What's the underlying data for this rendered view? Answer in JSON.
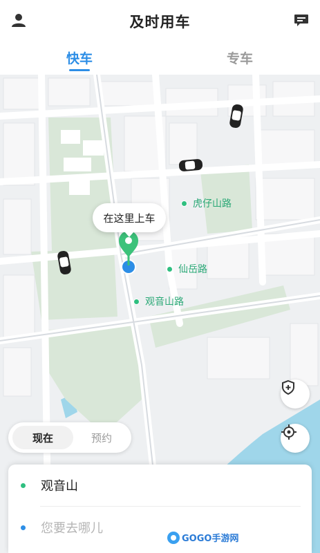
{
  "header": {
    "title": "及时用车",
    "tabs": [
      {
        "label": "快车",
        "active": true
      },
      {
        "label": "专车",
        "active": false
      }
    ],
    "left_icon": "user-icon",
    "right_icon": "message-icon"
  },
  "map": {
    "pickup_bubble": "在这里上车",
    "pois": [
      "虎仔山路",
      "仙岳路",
      "观音山路"
    ]
  },
  "time_toggle": {
    "now_label": "现在",
    "book_label": "预约"
  },
  "address": {
    "from": "观音山",
    "to_placeholder": "您要去哪儿"
  },
  "watermark": "GOGO手游网",
  "colors": {
    "accent": "#2d8ee6",
    "poi_green": "#2fbf80",
    "pin_green": "#3cc27a"
  }
}
